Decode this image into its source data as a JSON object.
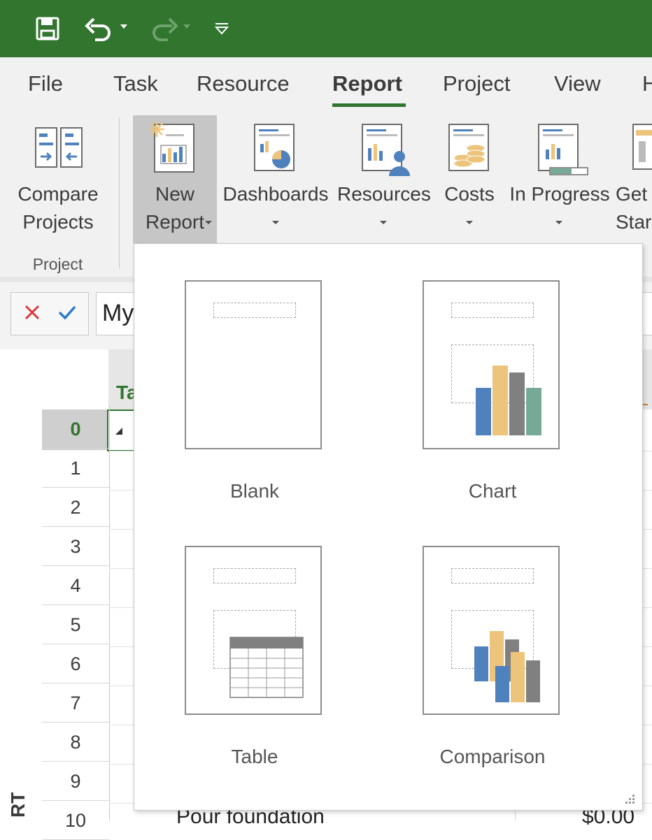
{
  "tabs": [
    "File",
    "Task",
    "Resource",
    "Report",
    "Project",
    "View",
    "H"
  ],
  "active_tab": "Report",
  "ribbon": {
    "compare_projects": "Compare\nProjects",
    "group_project": "Project",
    "new_report": "New\nReport",
    "dashboards": "Dashboards",
    "resources": "Resources",
    "costs": "Costs",
    "in_progress": "In Progress",
    "getting_started": "Get\nStar"
  },
  "formula": {
    "value": "My"
  },
  "grid": {
    "header_partial": "Ta",
    "rows": [
      "0",
      "1",
      "2",
      "3",
      "4",
      "5",
      "6",
      "7",
      "8",
      "9",
      "10"
    ],
    "row10_name": "Pour foundation",
    "row10_cost": "$0.00",
    "view_label": "RT"
  },
  "gallery": {
    "items": [
      "Blank",
      "Chart",
      "Table",
      "Comparison"
    ]
  },
  "colors": {
    "title_green": "#31752f",
    "chart_blue": "#4f81bd",
    "chart_gold": "#ecc47b",
    "chart_gray": "#808080",
    "chart_teal": "#76aa96"
  },
  "icons": [
    "save-icon",
    "undo-icon",
    "redo-icon",
    "customize-qat-icon",
    "compare-projects-icon",
    "new-report-icon",
    "dashboards-icon",
    "resources-icon",
    "costs-icon",
    "in-progress-icon",
    "getting-started-icon",
    "cancel-icon",
    "enter-icon"
  ]
}
